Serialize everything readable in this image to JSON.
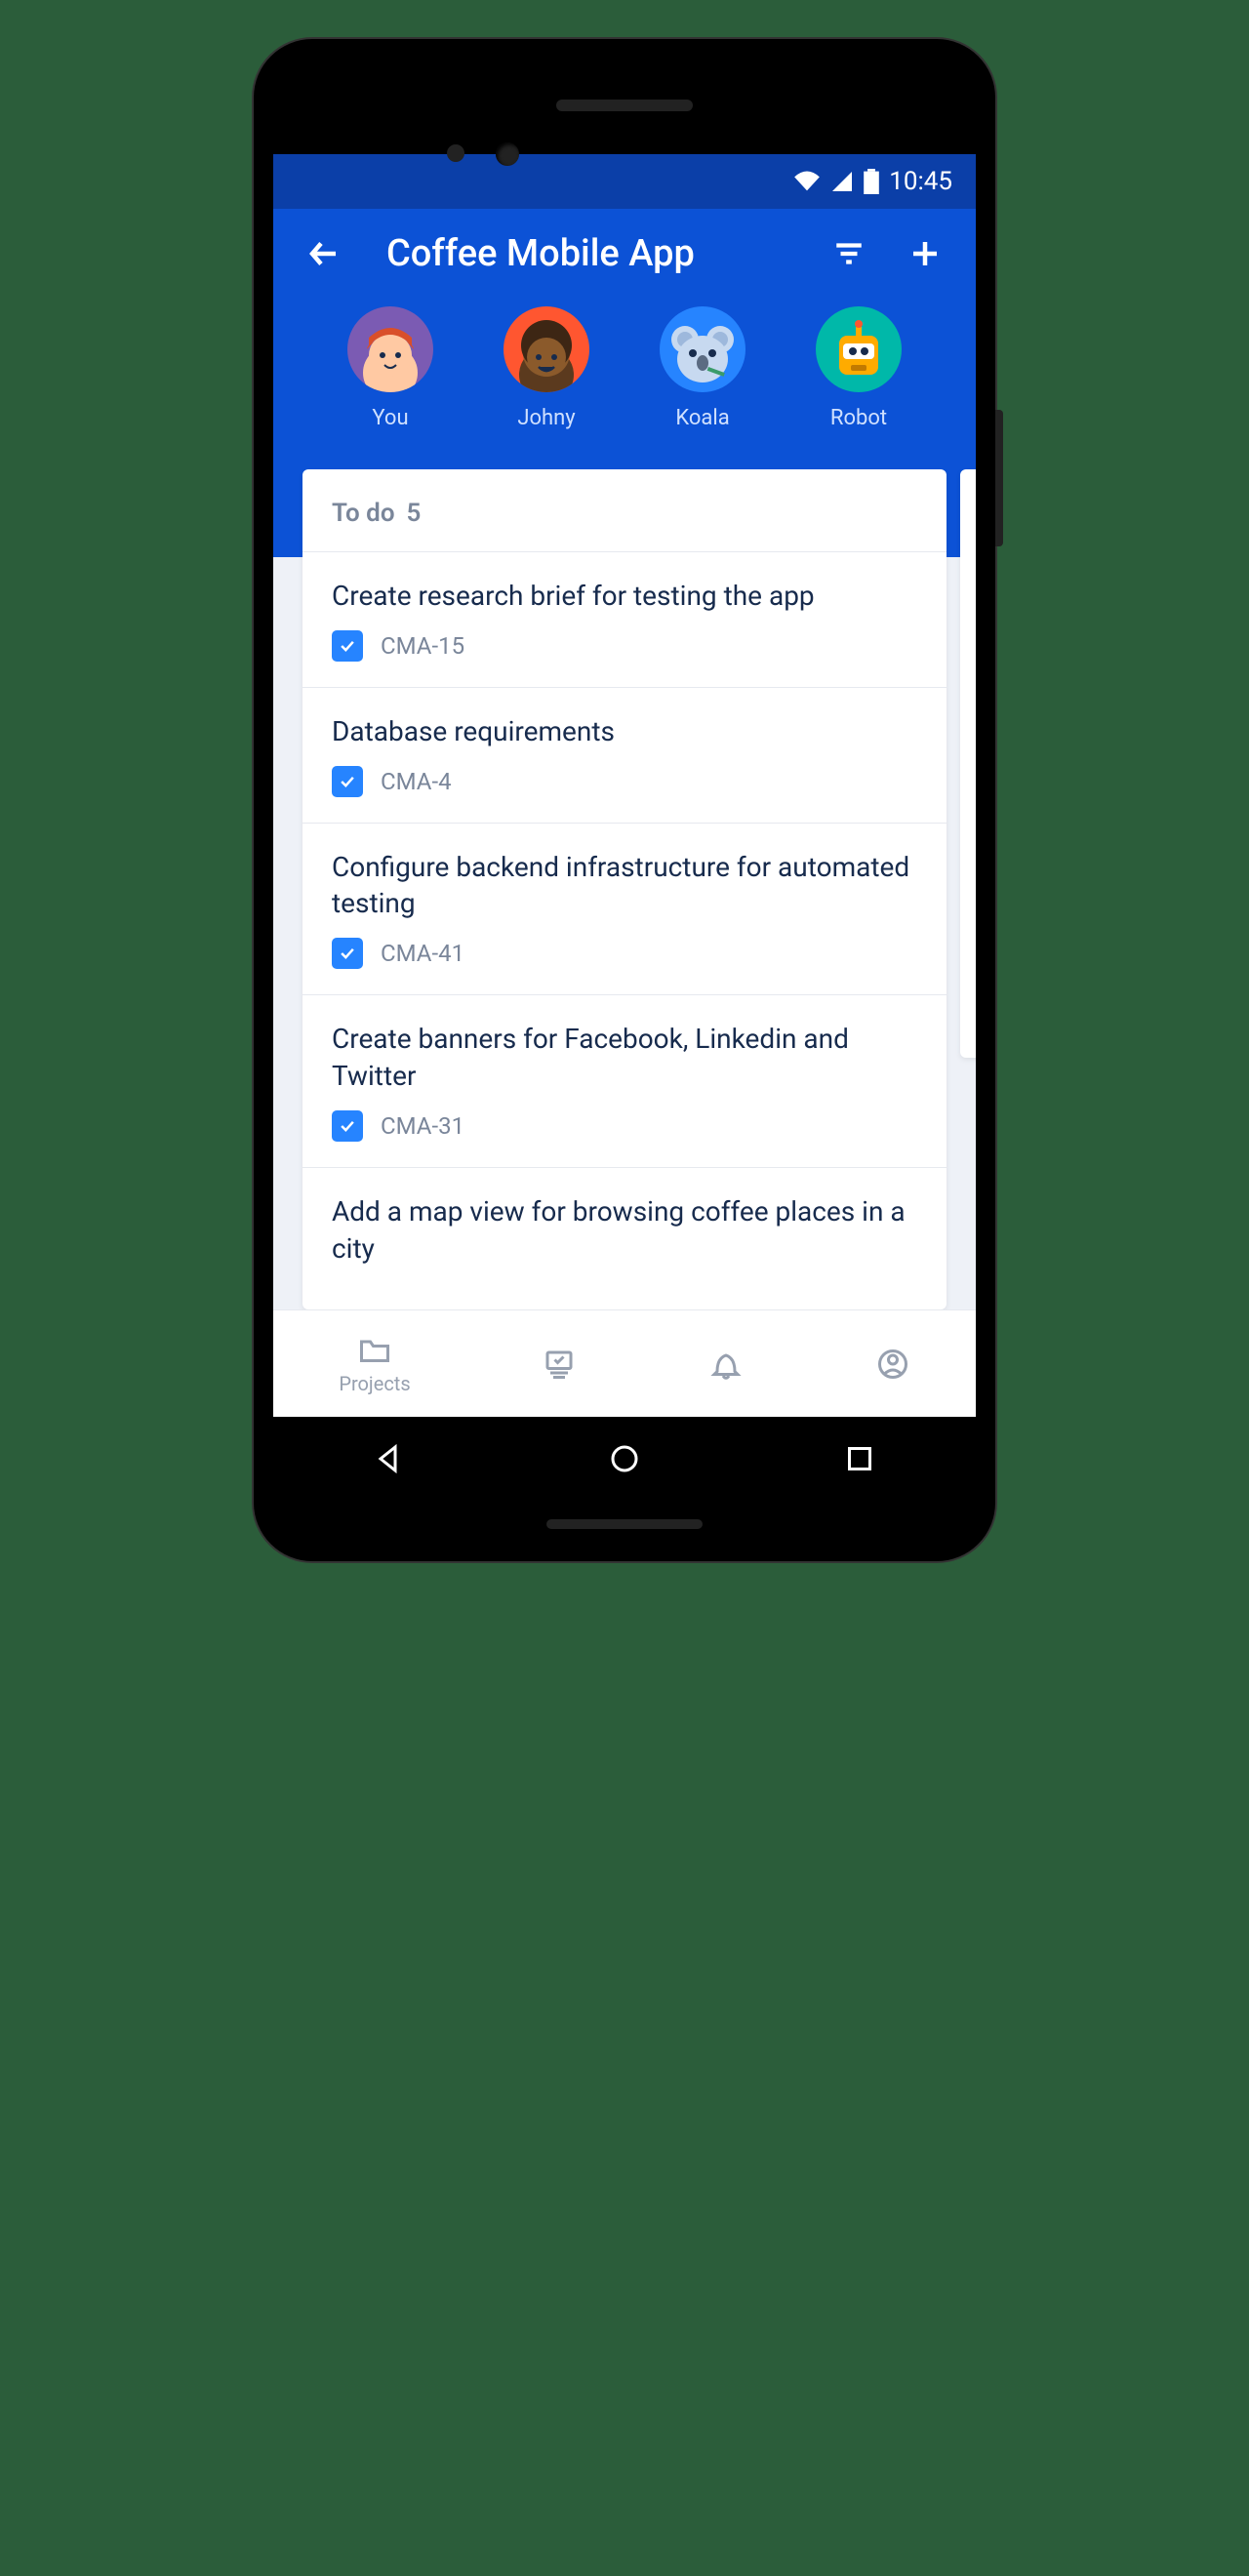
{
  "status": {
    "time": "10:45"
  },
  "header": {
    "title": "Coffee Mobile App"
  },
  "avatars": [
    {
      "name": "You",
      "bg": "face-bg-purple"
    },
    {
      "name": "Johny",
      "bg": "face-bg-orange"
    },
    {
      "name": "Koala",
      "bg": "face-bg-blue"
    },
    {
      "name": "Robot",
      "bg": "face-bg-teal"
    }
  ],
  "column": {
    "title": "To do",
    "count": "5",
    "cards": [
      {
        "title": "Create research brief for testing the app",
        "key": "CMA-15"
      },
      {
        "title": "Database requirements",
        "key": "CMA-4"
      },
      {
        "title": "Configure backend infrastructure for automated testing",
        "key": "CMA-41"
      },
      {
        "title": "Create banners for Facebook, Linkedin and Twitter",
        "key": "CMA-31"
      },
      {
        "title": "Add a map view for browsing coffee places in a city",
        "key": ""
      }
    ]
  },
  "bottomnav": {
    "projects": "Projects"
  }
}
